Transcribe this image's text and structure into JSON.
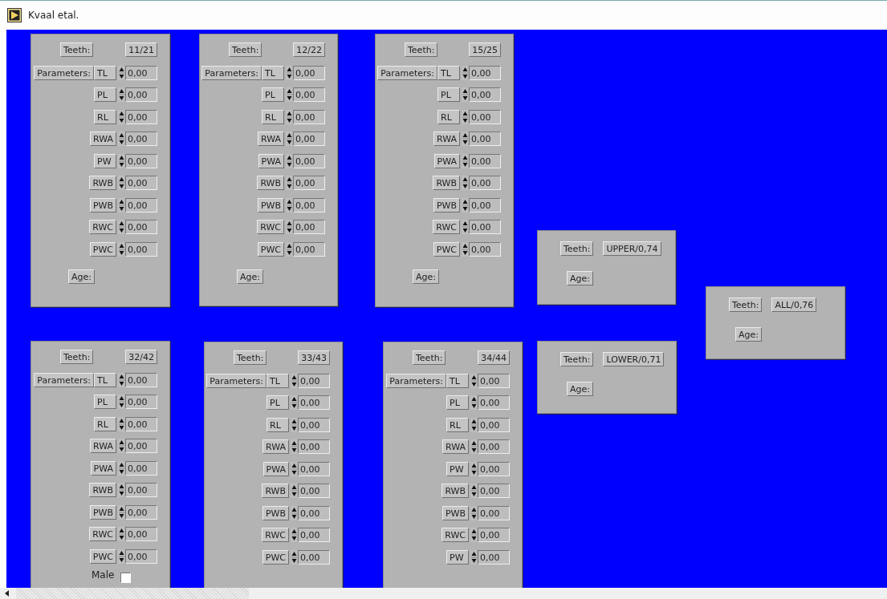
{
  "window": {
    "title": "Kvaal etal."
  },
  "panels": [
    {
      "kind": "teeth",
      "teeth_label": "Teeth:",
      "teeth": "11/21",
      "parameters_label": "Parameters:",
      "parameters": [
        {
          "name": "TL",
          "value": "0,00"
        },
        {
          "name": "PL",
          "value": "0,00"
        },
        {
          "name": "RL",
          "value": "0,00"
        },
        {
          "name": "RWA",
          "value": "0,00"
        },
        {
          "name": "PW",
          "value": "0,00"
        },
        {
          "name": "RWB",
          "value": "0,00"
        },
        {
          "name": "PWB",
          "value": "0,00"
        },
        {
          "name": "RWC",
          "value": "0,00"
        },
        {
          "name": "PWC",
          "value": "0,00"
        }
      ],
      "age_label": "Age:"
    },
    {
      "kind": "teeth",
      "teeth_label": "Teeth:",
      "teeth": "12/22",
      "parameters_label": "Parameters:",
      "parameters": [
        {
          "name": "TL",
          "value": "0,00"
        },
        {
          "name": "PL",
          "value": "0,00"
        },
        {
          "name": "RL",
          "value": "0,00"
        },
        {
          "name": "RWA",
          "value": "0,00"
        },
        {
          "name": "PWA",
          "value": "0,00"
        },
        {
          "name": "RWB",
          "value": "0,00"
        },
        {
          "name": "PWB",
          "value": "0,00"
        },
        {
          "name": "RWC",
          "value": "0,00"
        },
        {
          "name": "PWC",
          "value": "0,00"
        }
      ],
      "age_label": "Age:"
    },
    {
      "kind": "teeth",
      "teeth_label": "Teeth:",
      "teeth": "15/25",
      "parameters_label": "Parameters:",
      "parameters": [
        {
          "name": "TL",
          "value": "0,00"
        },
        {
          "name": "PL",
          "value": "0,00"
        },
        {
          "name": "RL",
          "value": "0,00"
        },
        {
          "name": "RWA",
          "value": "0,00"
        },
        {
          "name": "PWA",
          "value": "0,00"
        },
        {
          "name": "RWB",
          "value": "0,00"
        },
        {
          "name": "PWB",
          "value": "0,00"
        },
        {
          "name": "RWC",
          "value": "0,00"
        },
        {
          "name": "PWC",
          "value": "0,00"
        }
      ],
      "age_label": "Age:"
    },
    {
      "kind": "summary",
      "teeth_label": "Teeth:",
      "teeth": "UPPER/0,74",
      "age_label": "Age:"
    },
    {
      "kind": "summary",
      "teeth_label": "Teeth:",
      "teeth": "ALL/0,76",
      "age_label": "Age:"
    },
    {
      "kind": "teeth",
      "teeth_label": "Teeth:",
      "teeth": "32/42",
      "parameters_label": "Parameters:",
      "parameters": [
        {
          "name": "TL",
          "value": "0,00"
        },
        {
          "name": "PL",
          "value": "0,00"
        },
        {
          "name": "RL",
          "value": "0,00"
        },
        {
          "name": "RWA",
          "value": "0,00"
        },
        {
          "name": "PWA",
          "value": "0,00"
        },
        {
          "name": "RWB",
          "value": "0,00"
        },
        {
          "name": "PWB",
          "value": "0,00"
        },
        {
          "name": "RWC",
          "value": "0,00"
        },
        {
          "name": "PWC",
          "value": "0,00"
        }
      ],
      "male": {
        "label": "Male",
        "checked": false
      }
    },
    {
      "kind": "teeth",
      "teeth_label": "Teeth:",
      "teeth": "33/43",
      "parameters_label": "Parameters:",
      "parameters": [
        {
          "name": "TL",
          "value": "0,00"
        },
        {
          "name": "PL",
          "value": "0,00"
        },
        {
          "name": "RL",
          "value": "0,00"
        },
        {
          "name": "RWA",
          "value": "0,00"
        },
        {
          "name": "PWA",
          "value": "0,00"
        },
        {
          "name": "RWB",
          "value": "0,00"
        },
        {
          "name": "PWB",
          "value": "0,00"
        },
        {
          "name": "RWC",
          "value": "0,00"
        },
        {
          "name": "PWC",
          "value": "0,00"
        }
      ]
    },
    {
      "kind": "teeth",
      "teeth_label": "Teeth:",
      "teeth": "34/44",
      "parameters_label": "Parameters:",
      "parameters": [
        {
          "name": "TL",
          "value": "0,00"
        },
        {
          "name": "PL",
          "value": "0,00"
        },
        {
          "name": "RL",
          "value": "0,00"
        },
        {
          "name": "RWA",
          "value": "0,00"
        },
        {
          "name": "PW",
          "value": "0,00"
        },
        {
          "name": "RWB",
          "value": "0,00"
        },
        {
          "name": "PWB",
          "value": "0,00"
        },
        {
          "name": "RWC",
          "value": "0,00"
        },
        {
          "name": "PW",
          "value": "0,00"
        }
      ]
    },
    {
      "kind": "summary",
      "teeth_label": "Teeth:",
      "teeth": "LOWER/0,71",
      "age_label": "Age:"
    }
  ]
}
